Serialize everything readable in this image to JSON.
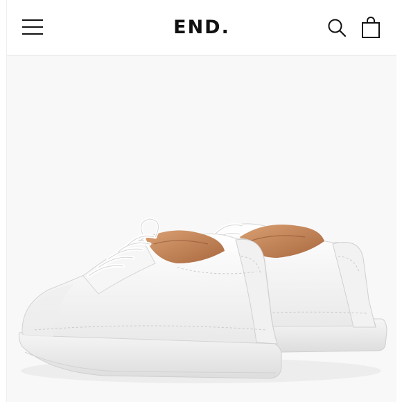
{
  "header": {
    "logo_text": "END.",
    "icons": {
      "menu": "hamburger-menu-icon",
      "search": "search-icon",
      "bag": "shopping-bag-icon"
    }
  },
  "product": {
    "image": "white-leather-sneakers-pair",
    "colors": {
      "leather": "#f4f4f4",
      "lining": "#c98a5a",
      "sole": "#ececec"
    }
  }
}
